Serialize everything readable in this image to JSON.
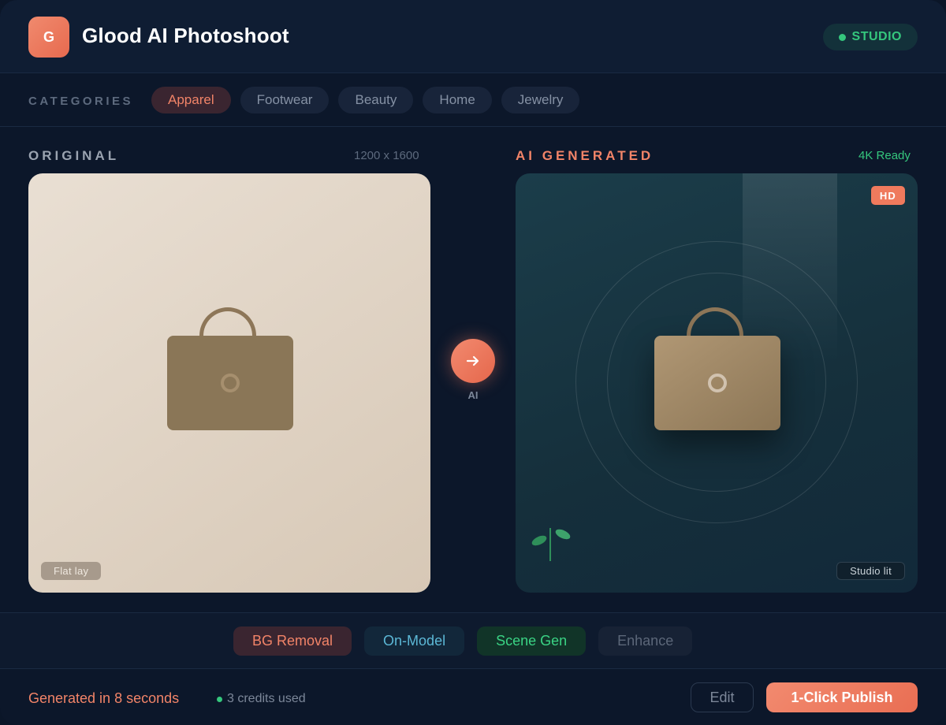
{
  "app": {
    "logo_letter": "G",
    "title": "Glood AI Photoshoot",
    "mode_badge": "STUDIO"
  },
  "categories": {
    "label": "CATEGORIES",
    "items": [
      {
        "label": "Apparel",
        "active": true
      },
      {
        "label": "Footwear",
        "active": false
      },
      {
        "label": "Beauty",
        "active": false
      },
      {
        "label": "Home",
        "active": false
      },
      {
        "label": "Jewelry",
        "active": false
      }
    ]
  },
  "original": {
    "heading": "ORIGINAL",
    "dimensions": "1200 x 1600",
    "tag": "Flat lay"
  },
  "transform": {
    "label": "AI"
  },
  "generated": {
    "heading": "AI GENERATED",
    "status": "4K Ready",
    "quality_badge": "HD",
    "tag": "Studio lit"
  },
  "features": [
    {
      "label": "BG Removal"
    },
    {
      "label": "On-Model"
    },
    {
      "label": "Scene Gen"
    },
    {
      "label": "Enhance"
    }
  ],
  "footer": {
    "generated_time": "Generated in 8 seconds",
    "credits": "3 credits used",
    "edit_label": "Edit",
    "publish_label": "1-Click Publish"
  },
  "colors": {
    "accent": "#f28468",
    "success": "#35c77d",
    "background": "#0c172a"
  }
}
